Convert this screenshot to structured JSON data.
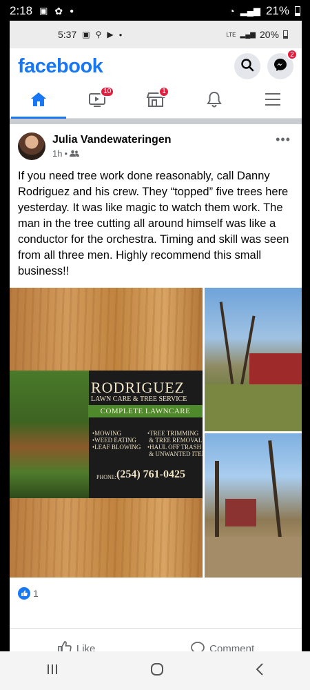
{
  "outer_status": {
    "time": "2:18",
    "battery": "21%"
  },
  "inner_status": {
    "time": "5:37",
    "network": "LTE",
    "battery": "20%"
  },
  "header": {
    "logo": "facebook",
    "messenger_badge": "2"
  },
  "tabs": [
    {
      "name": "home",
      "badge": ""
    },
    {
      "name": "watch",
      "badge": "10"
    },
    {
      "name": "marketplace",
      "badge": "1"
    },
    {
      "name": "notifications",
      "badge": ""
    },
    {
      "name": "menu",
      "badge": ""
    }
  ],
  "post": {
    "author": "Julia Vandewateringen",
    "time": "1h",
    "text": "If you need tree work done reasonably, call Danny Rodriguez and his crew. They “topped” five trees here yesterday. It was like magic to watch them work. The man in the tree cutting all around himself was like a conductor for the orchestra. Timing and skill was seen from all three men. Highly recommend this small business!!",
    "card": {
      "title": "RODRIGUEZ",
      "subtitle": "LAWN CARE & TREE SERVICE",
      "banner": "COMPLETE LAWNCARE",
      "services_left": "•MOWING\n•WEED EATING\n•LEAF BLOWING",
      "services_right": "•TREE TRIMMING\n & TREE REMOVAL\n•HAUL OFF TRASH\n & UNWANTED ITEMS",
      "phone_label": "PHONE:",
      "phone": "(254) 761-0425"
    },
    "reaction_count": "1"
  },
  "actions": {
    "like": "Like",
    "comment": "Comment"
  }
}
